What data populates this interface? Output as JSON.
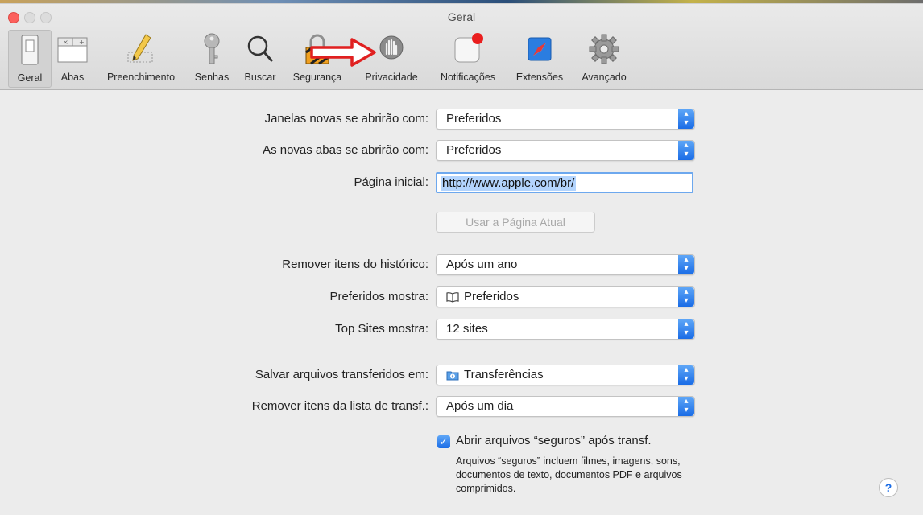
{
  "window": {
    "title": "Geral"
  },
  "toolbar": {
    "items": [
      {
        "label": "Geral",
        "icon": "general-switch-icon",
        "selected": true
      },
      {
        "label": "Abas",
        "icon": "tabs-icon"
      },
      {
        "label": "Preenchimento",
        "icon": "autofill-pencil-icon"
      },
      {
        "label": "Senhas",
        "icon": "key-icon"
      },
      {
        "label": "Buscar",
        "icon": "magnifier-icon"
      },
      {
        "label": "Segurança",
        "icon": "security-lock-icon"
      },
      {
        "label": "Privacidade",
        "icon": "privacy-hand-icon"
      },
      {
        "label": "Notificações",
        "icon": "notifications-badge-icon"
      },
      {
        "label": "Extensões",
        "icon": "extensions-puzzle-icon"
      },
      {
        "label": "Avançado",
        "icon": "advanced-gear-icon"
      }
    ]
  },
  "settings": {
    "new_windows": {
      "label": "Janelas novas se abrirão com:",
      "value": "Preferidos"
    },
    "new_tabs": {
      "label": "As novas abas se abrirão com:",
      "value": "Preferidos"
    },
    "homepage": {
      "label": "Página inicial:",
      "value": "http://www.apple.com/br/"
    },
    "use_current_page": "Usar a Página Atual",
    "remove_history": {
      "label": "Remover itens do histórico:",
      "value": "Após um ano"
    },
    "favorites_shows": {
      "label": "Preferidos mostra:",
      "value": "Preferidos"
    },
    "top_sites": {
      "label": "Top Sites mostra:",
      "value": "12 sites"
    },
    "save_downloads": {
      "label": "Salvar arquivos transferidos em:",
      "value": "Transferências"
    },
    "remove_downloads": {
      "label": "Remover itens da lista de transf.:",
      "value": "Após um dia"
    },
    "open_safe": {
      "label": "Abrir arquivos “seguros” após transf.",
      "checked": true,
      "note": "Arquivos “seguros” incluem filmes, imagens, sons, documentos de texto, documentos PDF e arquivos comprimidos."
    }
  },
  "help": "?"
}
